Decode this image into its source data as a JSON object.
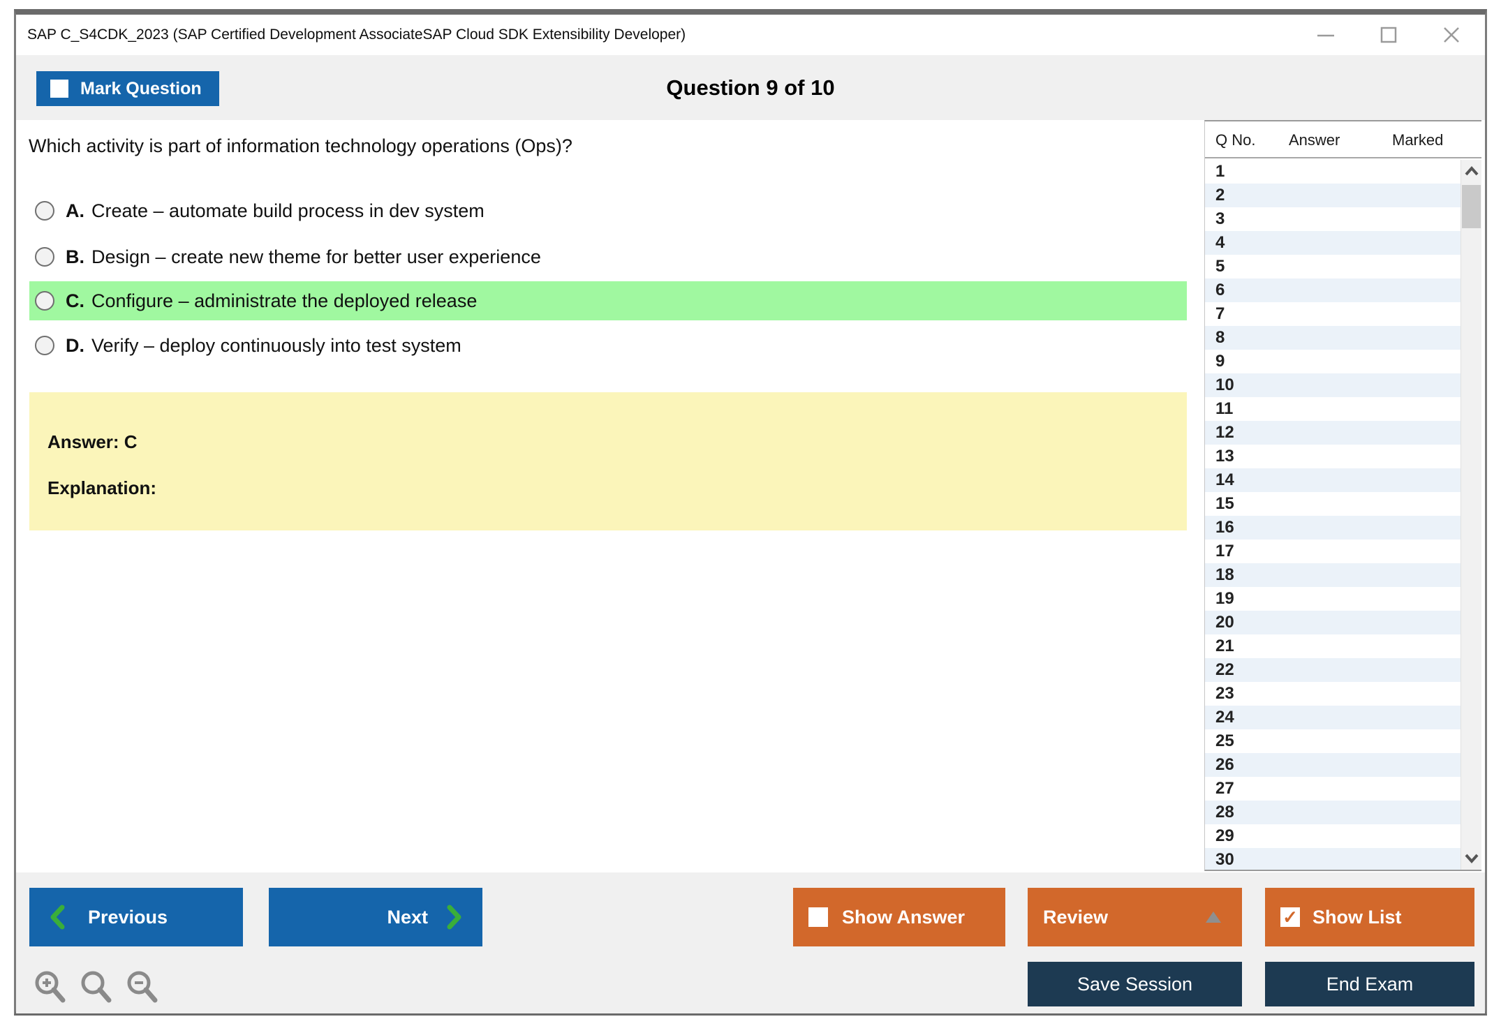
{
  "window": {
    "title": "SAP C_S4CDK_2023 (SAP Certified Development AssociateSAP Cloud SDK Extensibility Developer)",
    "controls": {
      "minimize": "minimize-icon",
      "maximize": "maximize-icon",
      "close": "close-icon"
    }
  },
  "header": {
    "mark_question_label": "Mark Question",
    "question_counter": "Question 9 of 10"
  },
  "question": {
    "text": "Which activity is part of information technology operations (Ops)?",
    "options": [
      {
        "letter": "A.",
        "text": "Create – automate build process in dev system",
        "highlighted": false
      },
      {
        "letter": "B.",
        "text": "Design – create new theme for better user experience",
        "highlighted": false
      },
      {
        "letter": "C.",
        "text": "Configure – administrate the deployed release",
        "highlighted": true
      },
      {
        "letter": "D.",
        "text": "Verify – deploy continuously into test system",
        "highlighted": false
      }
    ]
  },
  "answer_panel": {
    "answer": "Answer: C",
    "explanation": "Explanation:"
  },
  "sidebar": {
    "columns": {
      "qno": "Q No.",
      "answer": "Answer",
      "marked": "Marked"
    },
    "rows": [
      "1",
      "2",
      "3",
      "4",
      "5",
      "6",
      "7",
      "8",
      "9",
      "10",
      "11",
      "12",
      "13",
      "14",
      "15",
      "16",
      "17",
      "18",
      "19",
      "20",
      "21",
      "22",
      "23",
      "24",
      "25",
      "26",
      "27",
      "28",
      "29",
      "30"
    ]
  },
  "footer": {
    "previous": "Previous",
    "next": "Next",
    "show_answer": "Show Answer",
    "review": "Review",
    "show_list": "Show List",
    "save_session": "Save Session",
    "end_exam": "End Exam",
    "show_list_checked": "✓",
    "zoom_icons": [
      "zoom-in-icon",
      "search-icon",
      "zoom-out-icon"
    ]
  },
  "colors": {
    "accent_blue": "#1565ab",
    "accent_orange": "#d2682b",
    "navy": "#1d3a52",
    "highlight_green": "#a0f8a0",
    "answer_yellow": "#fbf5ba",
    "row_alt_blue": "#ebf2f9",
    "chevron_green": "#3aae3a",
    "header_gray": "#f0f0f0"
  }
}
